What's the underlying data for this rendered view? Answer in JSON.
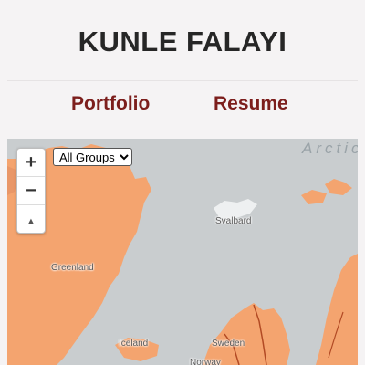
{
  "site": {
    "title": "KUNLE FALAYI"
  },
  "nav": {
    "items": [
      {
        "label": "Portfolio"
      },
      {
        "label": "Resume"
      }
    ]
  },
  "map": {
    "controls": {
      "zoom_in_label": "+",
      "zoom_out_label": "−",
      "reset_bearing_label": "▲",
      "group_select": {
        "selected": "All Groups",
        "options": [
          "All Groups"
        ]
      }
    },
    "labels": {
      "arctic": "Arctic",
      "svalbard": "Svalbard",
      "greenland": "Greenland",
      "iceland": "Iceland",
      "sweden": "Sweden",
      "norway": "Norway"
    },
    "colors": {
      "land": "#f4a46f",
      "water": "#c9cdcf",
      "border": "#b24a24"
    }
  }
}
